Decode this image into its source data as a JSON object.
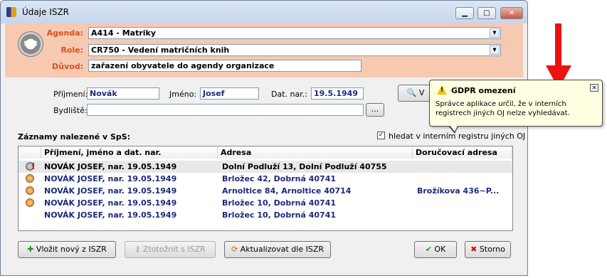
{
  "window": {
    "title": "Údaje ISZR"
  },
  "header": {
    "logo_text": "SZR",
    "agenda_label": "Agenda:",
    "agenda_value": "A414 - Matriky",
    "role_label": "Role:",
    "role_value": "CR750 - Vedení matričních knih",
    "reason_label": "Důvod:",
    "reason_value": "zařazení obyvatele do agendy organizace"
  },
  "search": {
    "surname_label": "Příjmení:",
    "surname_value": "Novák",
    "firstname_label": "Jméno:",
    "firstname_value": "Josef",
    "birthdate_label": "Dat. nar.:",
    "birthdate_value": "19.5.1949",
    "address_label": "Bydliště:",
    "address_value": "",
    "browse_label": "...",
    "search_button_label": "V"
  },
  "results": {
    "title": "Záznamy nalezené v SpS:",
    "checkbox_label": "hledat v interním registru jiných OJ",
    "checkbox_checked": true,
    "columns": [
      "Příjmení, jméno a dat. nar.",
      "Adresa",
      "Doručovací adresa"
    ],
    "rows": [
      {
        "icon": "warning-person-icon",
        "name": "NOVÁK JOSEF, nar. 19.05.1949",
        "address": "Dolní Podluží 13, Dolní Podluží 40755",
        "delivery": "",
        "color": "#000000"
      },
      {
        "icon": "person-icon",
        "name": "NOVÁK JOSEF, nar. 19.05.1949",
        "address": "Brložec 42, Dobrná 40741",
        "delivery": "",
        "color": "#1c2a7a"
      },
      {
        "icon": "person-icon",
        "name": "NOVÁK JOSEF, nar. 19.05.1949",
        "address": "Arnoltice 84, Arnoltice 40714",
        "delivery": "Brožíkova 436~P...",
        "color": "#1c2a7a"
      },
      {
        "icon": "person-icon",
        "name": "NOVÁK JOSEF, nar. 19.05.1949",
        "address": "Brložec 10, Dobrná 40741",
        "delivery": "",
        "color": "#1c2a7a"
      },
      {
        "icon": "none",
        "name": "NOVÁK JOSEF, nar. 19.05.1949",
        "address": "Brložec 10, Dobrná 40741",
        "delivery": "",
        "color": "#1c2a7a"
      }
    ]
  },
  "buttons": {
    "insert_new": "Vložit nový z ISZR",
    "identify": "Ztotožnit s ISZR",
    "update": "Aktualizovat dle ISZR",
    "ok": "OK",
    "cancel": "Storno"
  },
  "tooltip": {
    "title": "GDPR omezení",
    "body": "Správce aplikace určil, že v interních registrech jiných OJ nelze vyhledávat."
  },
  "colors": {
    "header_bg": "#f7c9b0",
    "label_orange": "#d9501e",
    "row_blue": "#1c2a7a",
    "arrow_red": "#ee1111"
  }
}
